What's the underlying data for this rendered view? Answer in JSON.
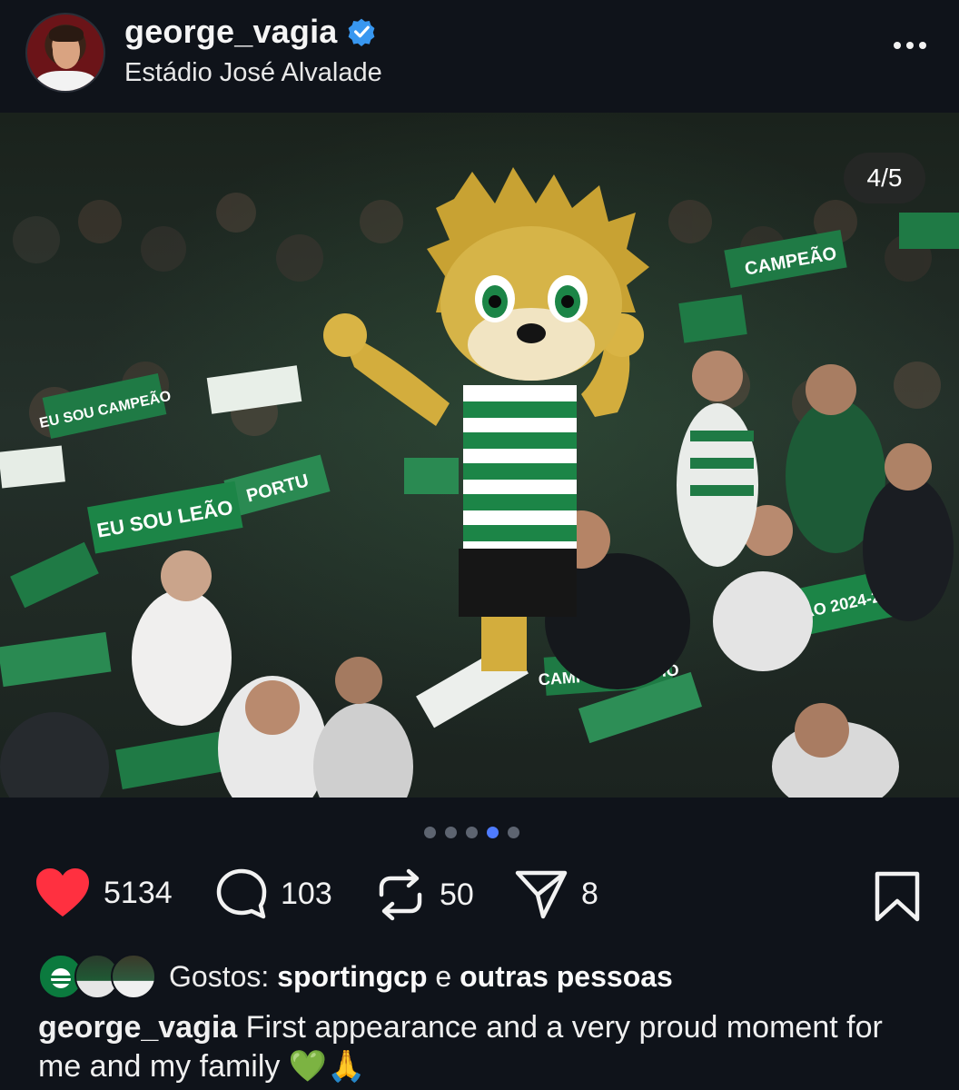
{
  "post": {
    "username": "george_vagia",
    "location": "Estádio José Alvalade",
    "counter": "4/5",
    "current_slide": 4,
    "total_slides": 5
  },
  "actions": {
    "likes": "5134",
    "comments": "103",
    "reposts": "50",
    "shares": "8"
  },
  "likes_line": {
    "prefix": "Gostos:",
    "user": "sportingcp",
    "joiner": "e",
    "others": "outras pessoas"
  },
  "caption": {
    "username": "george_vagia",
    "text": "First appearance and a very proud moment for me and my family 💚🙏"
  },
  "photo_text": {
    "scarf_1": "EU SOU LEÃO",
    "scarf_2": "CAMPEÃO",
    "scarf_3": "CAMPEÃO NACIO",
    "scarf_4": "BICAMPEÃO 2024-2025",
    "scarf_5": "EU SOU CAMPEÃO",
    "scarf_6": "PORTU"
  },
  "colors": {
    "background": "#0f131a",
    "like_red": "#ff3040",
    "dot_active": "#4f7cff",
    "verified_blue": "#3897f0",
    "sporting_green": "#0b7a3e"
  }
}
